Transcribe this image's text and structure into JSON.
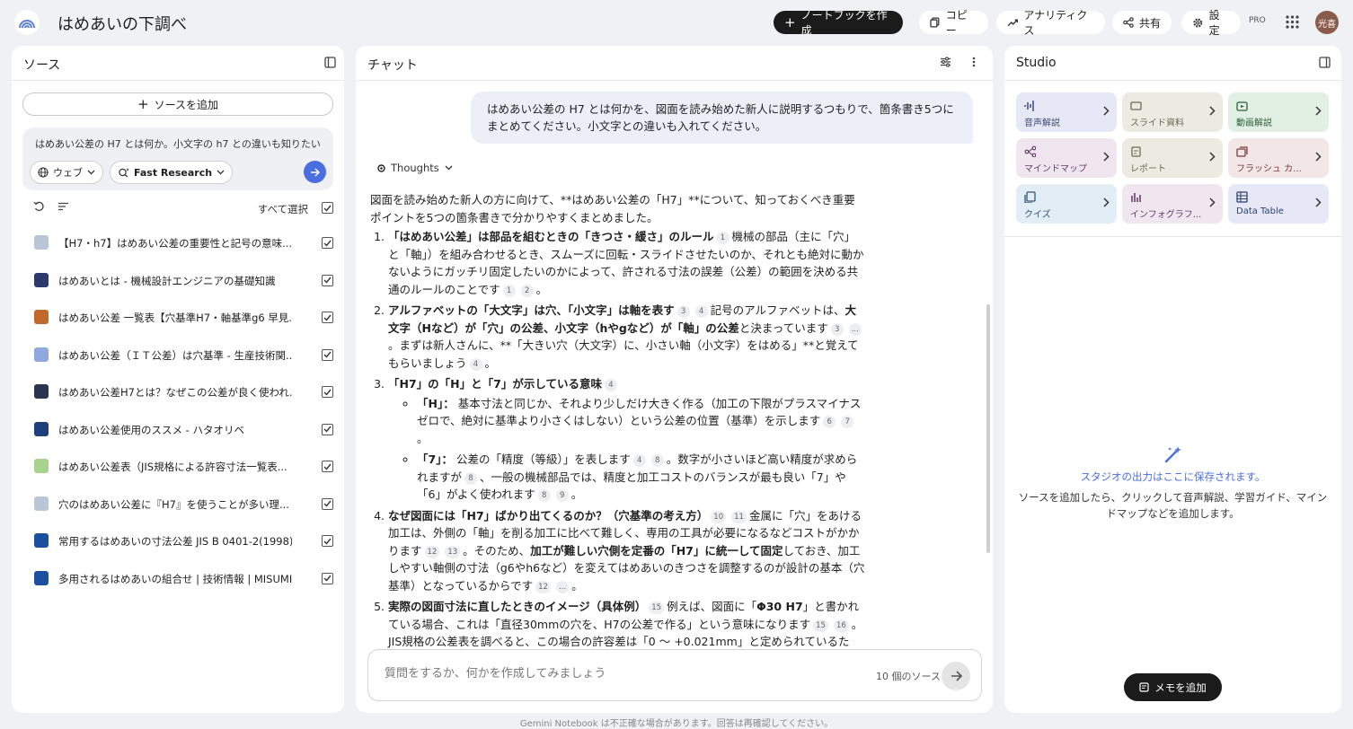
{
  "app": {
    "title": "はめあいの下調べ"
  },
  "toolbar": {
    "create": "ノートブックを作成",
    "copy": "コピー",
    "analytics": "アナリティクス",
    "share": "共有",
    "settings": "設定",
    "pro": "PRO",
    "avatar": "光喜"
  },
  "sources": {
    "title": "ソース",
    "add": "ソースを追加",
    "query": "はめあい公差の H7 とは何か。小文字の h7 との違いも知りたい",
    "web_chip": "ウェブ",
    "research_chip": "Fast Research",
    "select_all": "すべて選択",
    "items": [
      {
        "label": "【H7・h7】はめあい公差の重要性と記号の意味...",
        "icon_color": "#b8c6d8"
      },
      {
        "label": "はめあいとは - 機械設計エンジニアの基礎知識",
        "icon_color": "#2d3a6b"
      },
      {
        "label": "はめあい公差 一覧表【穴基準H7・軸基準g6 早見...",
        "icon_color": "#c0692b"
      },
      {
        "label": "はめあい公差（ＩＴ公差）は穴基準 - 生産技術関...",
        "icon_color": "#8fa8e0"
      },
      {
        "label": "はめあい公差H7とは？なぜこの公差が良く使われ...",
        "icon_color": "#2b3550"
      },
      {
        "label": "はめあい公差使用のススメ - ハタオリベ",
        "icon_color": "#1d3f7a"
      },
      {
        "label": "はめあい公差表（JIS規格による許容寸法一覧表...",
        "icon_color": "#a7d48c"
      },
      {
        "label": "穴のはめあい公差に『H7』を使うことが多い理...",
        "icon_color": "#b8c6d8"
      },
      {
        "label": "常用するはめあいの寸法公差 JIS B 0401-2(1998)...",
        "icon_color": "#1d4fa0"
      },
      {
        "label": "多用されるはめあいの組合せ | 技術情報 | MISUMI...",
        "icon_color": "#1d4fa0"
      }
    ]
  },
  "chat": {
    "title": "チャット",
    "user_message": "はめあい公差の H7 とは何かを、図面を読み始めた新人に説明するつもりで、箇条書き5つにまとめてください。小文字との違いも入れてください。",
    "thoughts": "Thoughts",
    "intro": "図面を読み始めた新人の方に向けて、**はめあい公差の「H7」**について、知っておくべき重要ポイントを5つの箇条書きで分かりやすくまとめました。",
    "p1": {
      "bold": "「はめあい公差」は部品を組むときの「きつさ・緩さ」のルール",
      "c1": "1",
      "text": "機械の部品（主に「穴」と「軸」）を組み合わせるとき、スムーズに回転・スライドさせたいのか、それとも絶対に動かないようにガッチリ固定したいのかによって、許される寸法の誤差（公差）の範囲を決める共通のルールのことです",
      "c2": "1",
      "c3": "2",
      "end": "。"
    },
    "p2": {
      "bold": "アルファベットの「大文字」は穴、「小文字」は軸を表す",
      "c1": "3",
      "c2": "4",
      "text1": "記号のアルファベットは、",
      "bold2": "大文字（Hなど）が「穴」の公差、小文字（hやgなど）が「軸」の公差",
      "text2": "と決まっています",
      "c3": "3",
      "c4": "...",
      "text3": "。まずは新人さんに、**「大きい穴（大文字）に、小さい軸（小文字）をはめる」**と覚えてもらいましょう",
      "c5": "4",
      "end": "。"
    },
    "p3": {
      "bold": "「H7」の「H」と「7」が示している意味",
      "c1": "4",
      "h_bold": "「H」：",
      "h_text": "基本寸法と同じか、それより少しだけ大きく作る（加工の下限がプラスマイナスゼロで、絶対に基準より小さくはしない）という公差の位置（基準）を示します",
      "h_c1": "6",
      "h_c2": "7",
      "h_end": "。",
      "s_bold": "「7」：",
      "s_text1": "公差の「精度（等級）」を表します",
      "s_c1": "4",
      "s_c2": "8",
      "s_text2": "。数字が小さいほど高い精度が求められますが",
      "s_c3": "8",
      "s_text3": "、一般の機械部品では、精度と加工コストのバランスが最も良い「7」や「6」がよく使われます",
      "s_c4": "8",
      "s_c5": "9",
      "s_end": "。"
    },
    "p4": {
      "bold": "なぜ図面には「H7」ばかり出てくるのか？（穴基準の考え方）",
      "c1": "10",
      "c2": "11",
      "text1": "金属に「穴」をあける加工は、外側の「軸」を削る加工に比べて難しく、専用の工具が必要になるなどコストがかかります",
      "c3": "12",
      "c4": "13",
      "text2": "。そのため、",
      "bold2": "加工が難しい穴側を定番の「H7」に統一して固定",
      "text3": "しておき、加工しやすい軸側の寸法（g6やh6など）を変えてはめあいのきつさを調整するのが設計の基本（穴基準）となっているからです",
      "c5": "12",
      "c6": "...",
      "end": "。"
    },
    "p5": {
      "bold": "実際の図面寸法に直したときのイメージ（具体例）",
      "c1": "15",
      "text1": "例えば、図面に「",
      "bold2": "Φ30 H7",
      "text2": "」と書かれている場合、これは「直径30mmの穴を、H7の公差で作る」という意味になります",
      "c2": "15",
      "c3": "16",
      "text3": "。JIS規格の公差表を調べると、この場合の許容差は「0 ～ +0.021mm」と定められているため..."
    },
    "placeholder": "質問をするか、何かを作成してみましょう",
    "source_count": "10 個のソース"
  },
  "studio": {
    "title": "Studio",
    "tiles": [
      {
        "label": "音声解説",
        "bg": "#e6e9f5",
        "fg": "#3b4a7a",
        "icon": "waveform-icon"
      },
      {
        "label": "スライド資料",
        "bg": "#ecebe2",
        "fg": "#6d6a55",
        "icon": "slides-icon"
      },
      {
        "label": "動画解説",
        "bg": "#e2f0e4",
        "fg": "#2f5e3a",
        "icon": "video-icon"
      },
      {
        "label": "マインドマップ",
        "bg": "#efe6f0",
        "fg": "#6a3b6e",
        "icon": "mindmap-icon"
      },
      {
        "label": "レポート",
        "bg": "#ecebe2",
        "fg": "#6d6a55",
        "icon": "report-icon"
      },
      {
        "label": "フラッシュ カ...",
        "bg": "#f3e6e6",
        "fg": "#7a3b3b",
        "icon": "flashcard-icon"
      },
      {
        "label": "クイズ",
        "bg": "#e3edf6",
        "fg": "#2f5677",
        "icon": "quiz-icon"
      },
      {
        "label": "インフォグラフ...",
        "bg": "#efe6f0",
        "fg": "#6a3b6e",
        "icon": "infographic-icon"
      },
      {
        "label": "Data Table",
        "bg": "#e6e9f5",
        "fg": "#2f3f6e",
        "icon": "table-icon"
      }
    ],
    "empty_title": "スタジオの出力はここに保存されます。",
    "empty_desc": "ソースを追加したら、クリックして音声解説、学習ガイド、マインドマップなどを追加します。",
    "memo": "メモを追加"
  },
  "footer": "Gemini Notebook は不正確な場合があります。回答は再確認してください。"
}
